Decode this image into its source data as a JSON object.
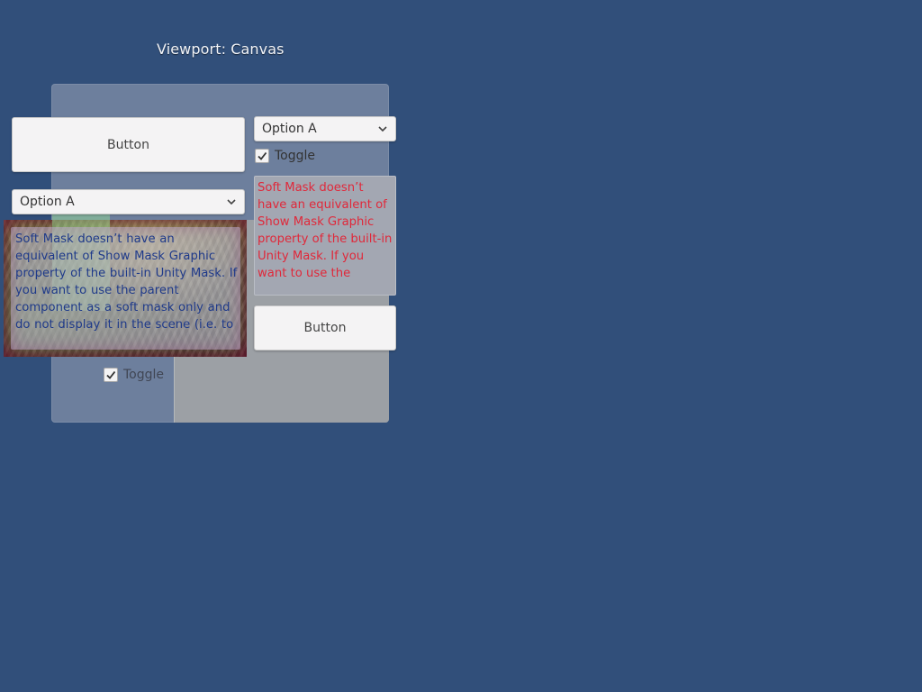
{
  "viewport_title": "Viewport: Canvas",
  "buttons": {
    "left_label": "Button",
    "right_label": "Button"
  },
  "dropdowns": {
    "left_selected": "Option A",
    "right_selected": "Option A"
  },
  "toggles": {
    "right": {
      "label": "Toggle",
      "checked": true
    },
    "left": {
      "label": "Toggle",
      "checked": true
    }
  },
  "text_right": "Soft Mask doesn’t have an equivalent of Show Mask Graphic property of the built-in Unity Mask. If you want to use the",
  "text_photo": "Soft Mask doesn’t have an equivalent of Show Mask Graphic property of the built-in Unity Mask. If you want to use the parent component as a soft mask only and do not display it in the scene (i.e. to",
  "icons": {
    "dropdown_arrow": "chevron-down-icon",
    "toggle_check": "checkmark-icon"
  },
  "colors": {
    "background": "#314f7a",
    "panel": "#6d7f9d",
    "panel_right": "#9ca0a5",
    "text_red": "#e0283a",
    "text_blue": "#1f3a8a"
  }
}
